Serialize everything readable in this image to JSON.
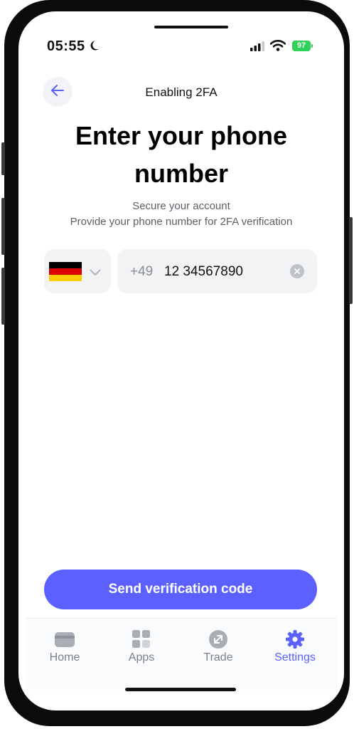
{
  "status_bar": {
    "time": "05:55",
    "battery": "97"
  },
  "header": {
    "title": "Enabling 2FA",
    "back_icon": "arrow-left-icon"
  },
  "main": {
    "headline_line1": "Enter your phone",
    "headline_line2": "number",
    "subtitle_line1": "Secure your account",
    "subtitle_line2": "Provide your phone number for 2FA verification",
    "country": {
      "flag_icon": "germany-flag-icon",
      "flag_colors": [
        "#000000",
        "#dd0000",
        "#ffce00"
      ]
    },
    "phone": {
      "prefix": "+49",
      "value": "12 34567890"
    },
    "submit_label": "Send verification code"
  },
  "tabbar": {
    "items": [
      {
        "label": "Home",
        "icon": "wallet-icon",
        "active": false
      },
      {
        "label": "Apps",
        "icon": "grid-icon",
        "active": false
      },
      {
        "label": "Trade",
        "icon": "swap-arrows-icon",
        "active": false
      },
      {
        "label": "Settings",
        "icon": "gear-icon",
        "active": true
      }
    ]
  },
  "colors": {
    "accent": "#5b60ff",
    "muted": "#7c8088",
    "field_bg": "#f2f3f5"
  }
}
